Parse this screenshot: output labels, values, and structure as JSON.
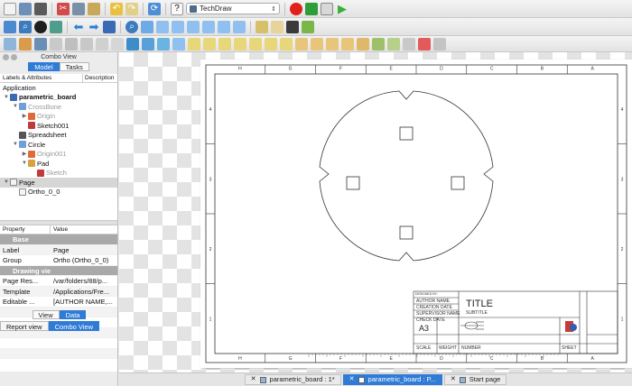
{
  "toolbar": {
    "workbench": "TechDraw",
    "colors": {
      "record": "#e0201a",
      "stop": "#2e9d3a",
      "play": "#3aae3a",
      "accent": "#2f7bd6"
    }
  },
  "combo": {
    "title": "Combo View",
    "tabs": [
      "Model",
      "Tasks"
    ],
    "columns": [
      "Labels & Attributes",
      "Description"
    ],
    "root": "Application",
    "tree": [
      {
        "label": "parametric_board",
        "icon": "document-icon",
        "level": 0,
        "arrow": "▼",
        "bold": true
      },
      {
        "label": "CrossBone",
        "icon": "part-icon",
        "level": 1,
        "arrow": "▼",
        "dim": true
      },
      {
        "label": "Origin",
        "icon": "origin-icon",
        "level": 2,
        "arrow": "▶",
        "dim": true
      },
      {
        "label": "Sketch001",
        "icon": "sketch-icon",
        "level": 2,
        "arrow": ""
      },
      {
        "label": "Spreadsheet",
        "icon": "spreadsheet-icon",
        "level": 1,
        "arrow": ""
      },
      {
        "label": "Circle",
        "icon": "part-icon",
        "level": 1,
        "arrow": "▼"
      },
      {
        "label": "Origin001",
        "icon": "origin-icon",
        "level": 2,
        "arrow": "▶",
        "dim": true
      },
      {
        "label": "Pad",
        "icon": "pad-icon",
        "level": 2,
        "arrow": "▼"
      },
      {
        "label": "Sketch",
        "icon": "sketch-icon",
        "level": 3,
        "arrow": "",
        "dim": true
      },
      {
        "label": "Page",
        "icon": "page-icon",
        "level": 0,
        "arrow": "▼",
        "selected": true
      },
      {
        "label": "Ortho_0_0",
        "icon": "view-icon",
        "level": 1,
        "arrow": ""
      }
    ],
    "prop_columns": [
      "Property",
      "Value"
    ],
    "properties": [
      {
        "group": true,
        "key": "Base",
        "value": ""
      },
      {
        "key": "Label",
        "value": "Page"
      },
      {
        "key": "Group",
        "value": "Ortho (Ortho_0_0)"
      },
      {
        "group": true,
        "key": "Drawing view",
        "value": ""
      },
      {
        "key": "Page Res...",
        "value": "/var/folders/88/p..."
      },
      {
        "key": "Template",
        "value": "/Applications/Fre..."
      },
      {
        "key": "Editable ...",
        "value": "[AUTHOR NAME,..."
      }
    ],
    "view_data": [
      "View",
      "Data"
    ],
    "bottom_tabs": [
      "Report view",
      "Combo View"
    ]
  },
  "sheet": {
    "col_labels": [
      "H",
      "G",
      "F",
      "E",
      "D",
      "C",
      "B",
      "A"
    ],
    "row_labels": [
      "4",
      "3",
      "2",
      "1"
    ],
    "title_block": {
      "author_label": "DESIGNED BY:",
      "author": "AUTHOR NAME",
      "date": "CREATION DATE",
      "supervisor": "SUPERVISOR NAME",
      "check_date": "CHECK DATE",
      "size": "A3",
      "title": "TITLE",
      "subtitle": "SUBTITLE",
      "scale": "SCALE",
      "weight": "WEIGHT",
      "number": "NUMBER",
      "sheet": "SHEET"
    }
  },
  "doc_tabs": [
    {
      "label": "parametric_board : 1*",
      "active": false
    },
    {
      "label": "parametric_board : P...",
      "active": true
    },
    {
      "label": "Start page",
      "active": false
    }
  ]
}
